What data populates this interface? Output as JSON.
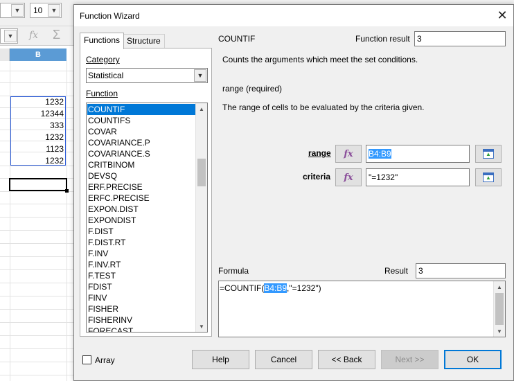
{
  "spreadsheet": {
    "font_size_value": "10",
    "column_label": "B",
    "cells": [
      "1232",
      "12344",
      "333",
      "1232",
      "1123",
      "1232"
    ]
  },
  "dialog": {
    "title": "Function Wizard",
    "close_glyph": "✕",
    "tabs": {
      "functions": "Functions",
      "structure": "Structure"
    },
    "category_label": "Category",
    "category_value": "Statistical",
    "function_label": "Function",
    "functions": [
      "COUNTIF",
      "COUNTIFS",
      "COVAR",
      "COVARIANCE.P",
      "COVARIANCE.S",
      "CRITBINOM",
      "DEVSQ",
      "ERF.PRECISE",
      "ERFC.PRECISE",
      "EXPON.DIST",
      "EXPONDIST",
      "F.DIST",
      "F.DIST.RT",
      "F.INV",
      "F.INV.RT",
      "F.TEST",
      "FDIST",
      "FINV",
      "FISHER",
      "FISHERINV",
      "FORECAST"
    ],
    "selected_function": "COUNTIF",
    "function_name": "COUNTIF",
    "function_result_label": "Function result",
    "function_result_value": "3",
    "description": "Counts the arguments which meet the set conditions.",
    "arg_title": "range (required)",
    "arg_description": "The range of cells to be evaluated by the criteria given.",
    "args": [
      {
        "label": "range",
        "value": "B4:B9"
      },
      {
        "label": "criteria",
        "value": "\"=1232\""
      }
    ],
    "formula_label": "Formula",
    "result_label": "Result",
    "result_value": "3",
    "formula": {
      "prefix": "=COUNTIF(",
      "highlight": "B4:B9",
      "suffix": ",\"=1232\")"
    },
    "array_label": "Array",
    "buttons": {
      "help": "Help",
      "cancel": "Cancel",
      "back": "<< Back",
      "next": "Next >>",
      "ok": "OK"
    }
  }
}
